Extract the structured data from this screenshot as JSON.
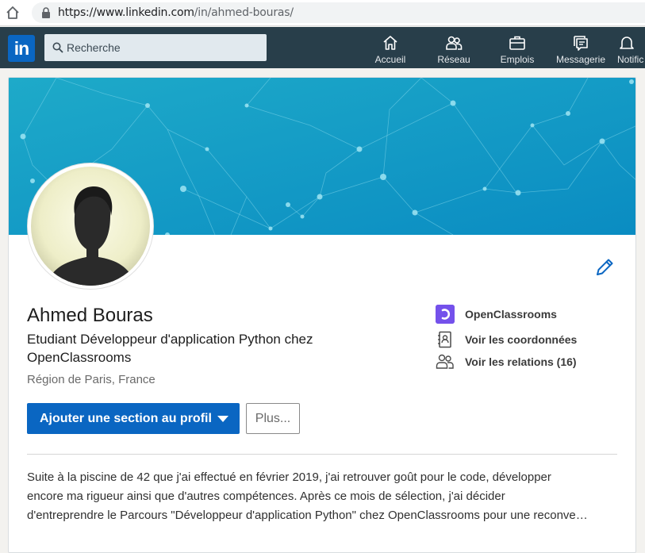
{
  "browser": {
    "url_prefix": "https://www.linkedin.com",
    "url_path": "/in/ahmed-bouras/"
  },
  "nav": {
    "logo": "in",
    "search_placeholder": "Recherche",
    "items": [
      {
        "label": "Accueil",
        "icon": "home-icon"
      },
      {
        "label": "Réseau",
        "icon": "network-icon"
      },
      {
        "label": "Emplois",
        "icon": "briefcase-icon"
      },
      {
        "label": "Messagerie",
        "icon": "messaging-icon"
      },
      {
        "label": "Notific",
        "icon": "bell-icon"
      }
    ]
  },
  "profile": {
    "name": "Ahmed Bouras",
    "headline": "Etudiant Développeur d'application Python chez OpenClassrooms",
    "location": "Région de Paris, France",
    "side": {
      "company": "OpenClassrooms",
      "contact": "Voir les coordonnées",
      "connections": "Voir les relations (16)"
    },
    "add_section_label": "Ajouter une section au profil",
    "more_label": "Plus...",
    "summary_lines": [
      "Suite à la piscine de 42 que j'ai effectué en février 2019, j'ai retrouver goût pour le code, développer",
      "encore ma rigueur ainsi que d'autres compétences. Après ce mois de sélection, j'ai décider",
      "d'entreprendre le Parcours \"Développeur d'application Python\" chez OpenClassrooms pour une reconve…"
    ]
  },
  "colors": {
    "nav_bg": "#283e4a",
    "brand_blue": "#0a66c2",
    "banner_start": "#1ba3c6",
    "banner_end": "#0b8fc4",
    "openclassrooms": "#7451eb"
  }
}
